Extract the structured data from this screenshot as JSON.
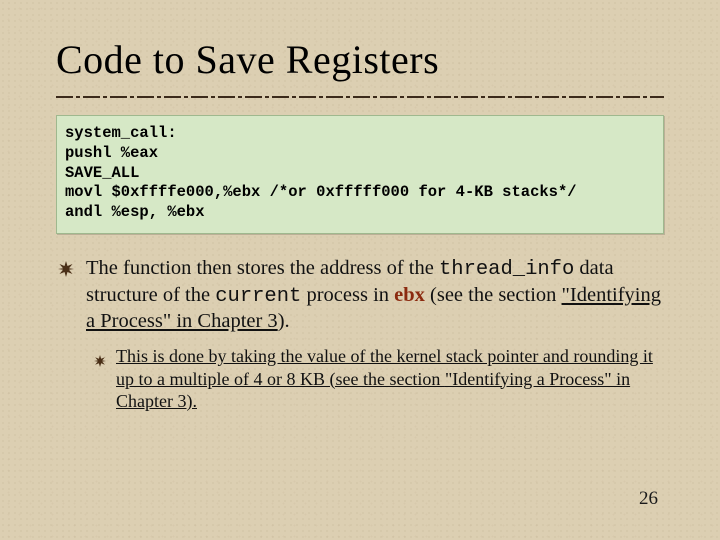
{
  "title": "Code to Save Registers",
  "code": {
    "l1": "system_call:",
    "l2": "pushl %eax",
    "l3": "SAVE_ALL",
    "l4": "movl $0xffffe000,%ebx /*or 0xfffff000 for 4-KB stacks*/",
    "l5": "andl %esp, %ebx"
  },
  "para": {
    "t0": "The function then stores the address of the ",
    "code0": "thread_info",
    "t1": " data structure of the ",
    "code1": "current",
    "t2": " process in ",
    "kw": "ebx",
    "t3": " (see the section ",
    "link0": "\"Identifying a Process\" in Chapter 3",
    "t4": ")."
  },
  "sub": {
    "t0": "This is done by taking the value of the kernel stack pointer and rounding it up to a multiple of 4 or 8 KB (see the section ",
    "link0": "\"Identifying a Process\" in Chapter 3",
    "t1": ")."
  },
  "pagenum": "26"
}
